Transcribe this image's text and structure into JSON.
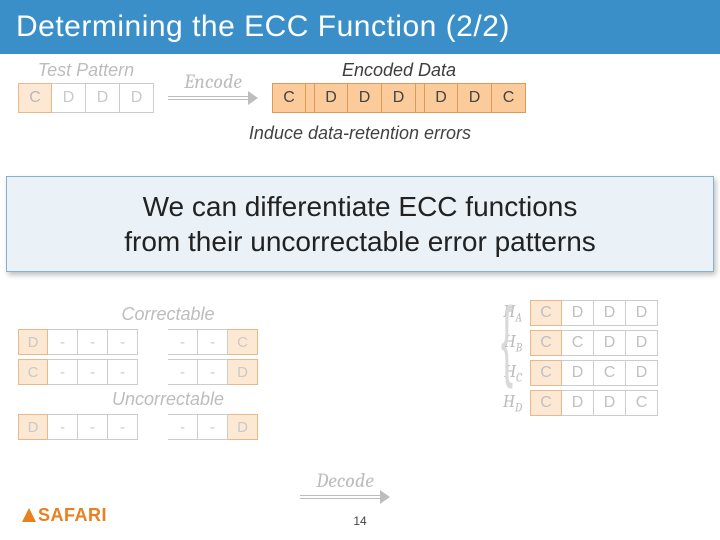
{
  "title": "Determining the ECC Function (2/2)",
  "labels": {
    "test_pattern": "Test Pattern",
    "encoded_data": "Encoded Data",
    "encode": "Encode",
    "decode": "Decode",
    "induce": "Induce data-retention errors",
    "correctable": "Correctable",
    "uncorrectable": "Uncorrectable"
  },
  "overlay": {
    "line1": "We can differentiate ECC functions",
    "line2": "from their uncorrectable error patterns"
  },
  "test_pattern_row": [
    "C",
    "D",
    "D",
    "D"
  ],
  "encoded_row": [
    "C",
    "D",
    "D",
    "D",
    "D",
    "D",
    "C"
  ],
  "correctable_rows": [
    [
      "D",
      "-",
      "-",
      "-",
      "-",
      "-",
      "C"
    ],
    [
      "C",
      "-",
      "-",
      "-",
      "-",
      "-",
      "D"
    ]
  ],
  "uncorrectable_rows": [
    [
      "D",
      "-",
      "-",
      "-",
      "-",
      "-",
      "D"
    ]
  ],
  "h_rows": [
    {
      "name": "H",
      "sub": "A",
      "cells": [
        "C",
        "D",
        "D",
        "D"
      ]
    },
    {
      "name": "H",
      "sub": "B",
      "cells": [
        "C",
        "C",
        "D",
        "D"
      ]
    },
    {
      "name": "H",
      "sub": "C",
      "cells": [
        "C",
        "D",
        "C",
        "D"
      ]
    },
    {
      "name": "H",
      "sub": "D",
      "cells": [
        "C",
        "D",
        "D",
        "C"
      ]
    }
  ],
  "page_number": "14",
  "logo_text": "SAFARI"
}
